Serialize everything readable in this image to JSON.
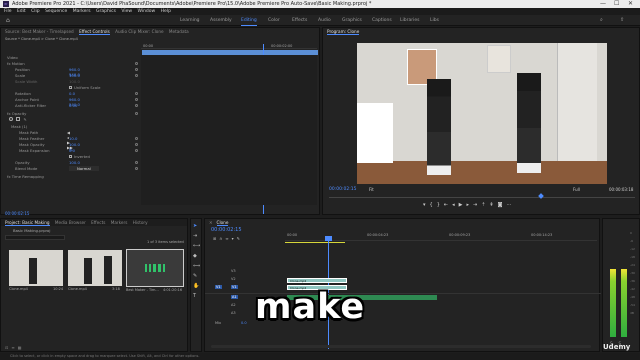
{
  "window": {
    "title": "Adobe Premiere Pro 2021 - C:\\Users\\David PhaSound\\Documents\\Adobe\\Premiere Pro\\15.0\\Adobe Premiere Pro Auto-Save\\Basic Making.prproj *"
  },
  "menu": [
    "File",
    "Edit",
    "Clip",
    "Sequence",
    "Markers",
    "Graphics",
    "View",
    "Window",
    "Help"
  ],
  "workspaces": [
    "Learning",
    "Assembly",
    "Editing",
    "Color",
    "Effects",
    "Audio",
    "Graphics",
    "Libraries",
    "Captions",
    "Libraries",
    "Libs"
  ],
  "active_workspace": "Editing",
  "source_panel": {
    "tabs": [
      "Source: Best Maker - Timelapsed",
      "Effect Controls",
      "Audio Clip Mixer: Clone",
      "Metadata"
    ],
    "active_tab": "Effect Controls",
    "subheader": "Source * Clone.mp4  >  Clone * Clone.mp4",
    "timecodes": [
      "00:00",
      "00:00:02:00"
    ],
    "clip_label": "Clone.mp4",
    "rows": [
      {
        "label": "Video",
        "value": ""
      },
      {
        "label": "fx  Motion",
        "value": ""
      },
      {
        "label": "Position",
        "value": "960.0    540.0"
      },
      {
        "label": "Scale",
        "value": "100.0"
      },
      {
        "label": "Scale Width",
        "value": "100.0"
      },
      {
        "label": "",
        "value": "Uniform Scale"
      },
      {
        "label": "Rotation",
        "value": "0.0"
      },
      {
        "label": "Anchor Point",
        "value": "960.0    540.0"
      },
      {
        "label": "Anti-flicker Filter",
        "value": "0.00"
      },
      {
        "label": "fx  Opacity",
        "value": ""
      },
      {
        "label": "Mask (1)",
        "value": ""
      },
      {
        "label": "Mask Path",
        "value": ""
      },
      {
        "label": "Mask Feather",
        "value": "10.0"
      },
      {
        "label": "Mask Opacity",
        "value": "100.0 %"
      },
      {
        "label": "Mask Expansion",
        "value": "0.0"
      },
      {
        "label": "",
        "value": "Inverted"
      },
      {
        "label": "Opacity",
        "value": "100.0 %"
      },
      {
        "label": "Blend Mode",
        "value": "Normal"
      },
      {
        "label": "fx  Time Remapping",
        "value": ""
      }
    ],
    "footer_time": "00:00:02:15"
  },
  "program": {
    "tab": "Program: Clone",
    "timecode": "00:00:02:15",
    "fit": "Fit",
    "quality": "Full",
    "duration": "00:00:03:18"
  },
  "project": {
    "tabs": [
      "Project: Basic Making",
      "Media Browser",
      "Effects",
      "Markers",
      "History"
    ],
    "file": "Basic Making.prproj",
    "items_selected": "1 of 3 items selected",
    "items": [
      {
        "name": "Clone.mp4",
        "duration": "10:24"
      },
      {
        "name": "Clone.mp4",
        "duration": "3:18"
      },
      {
        "name": "Best Maker - Tim...",
        "duration": "4:01:20:16"
      }
    ]
  },
  "timeline": {
    "tab": "Clone",
    "timecode": "00:00:02:15",
    "ruler": [
      "00:00",
      "00:00:04:23",
      "00:00:09:23",
      "00:00:14:23"
    ],
    "tracks": [
      "V3",
      "V2",
      "V1",
      "A1",
      "A2",
      "A3",
      "Mix"
    ],
    "clips": [
      "Clone.mp4",
      "Clone.mp4"
    ],
    "mix_value": "0.0"
  },
  "caption": "make",
  "watermark": "Udemy",
  "status": "Click to select, or click in empty space and drag to marquee select. Use Shift, Alt, and Ctrl for other options.",
  "colors": {
    "accent": "#4d8bff",
    "clip": "#8fc6c1",
    "meter_green": "#2fae3f"
  }
}
